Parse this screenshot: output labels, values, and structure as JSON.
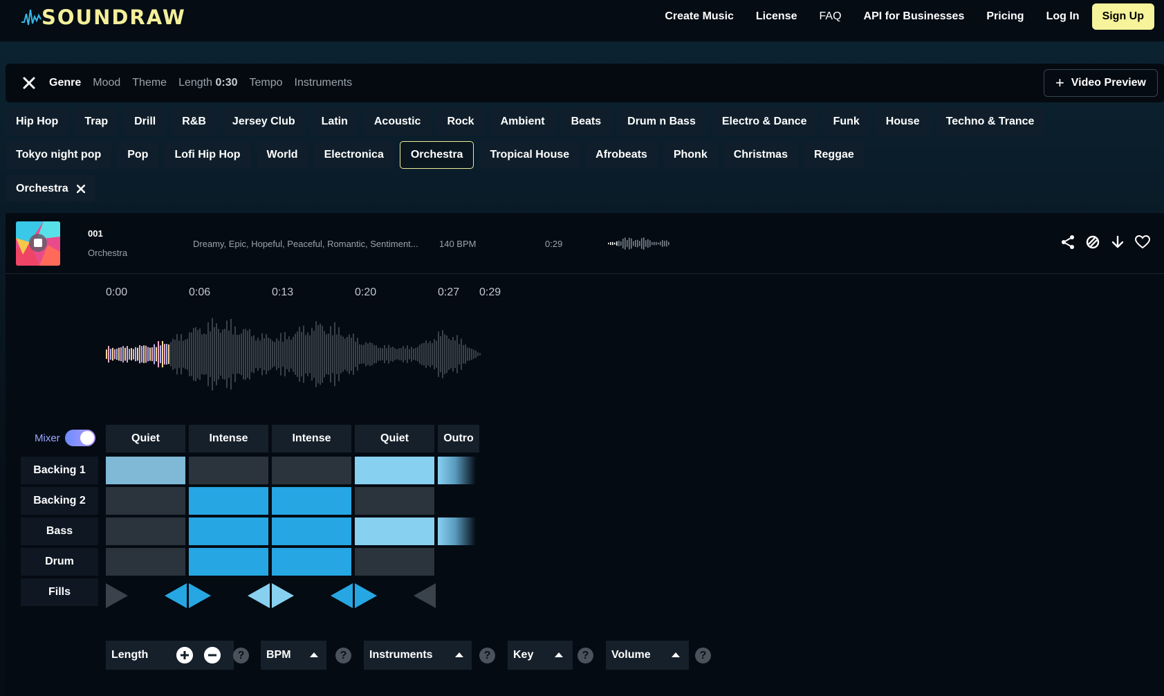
{
  "brand": {
    "name": "SOUNDRAW",
    "accent": "#f6f39a",
    "logo_icon": "waveform-logo-icon"
  },
  "nav": {
    "links": [
      "Create Music",
      "License",
      "FAQ",
      "API for Businesses",
      "Pricing",
      "Log In"
    ],
    "signup": "Sign Up"
  },
  "filters": {
    "tabs": [
      "Genre",
      "Mood",
      "Theme",
      "Length",
      "Tempo",
      "Instruments"
    ],
    "active_tab": "Genre",
    "length_value": "0:30",
    "video_preview": "Video Preview"
  },
  "genres": {
    "row1": [
      "Hip Hop",
      "Trap",
      "Drill",
      "R&B",
      "Jersey Club",
      "Latin",
      "Acoustic",
      "Rock",
      "Ambient",
      "Beats",
      "Drum n Bass",
      "Electro & Dance",
      "Funk",
      "House",
      "Techno & Trance"
    ],
    "row2": [
      "Tokyo night pop",
      "Pop",
      "Lofi Hip Hop",
      "World",
      "Electronica",
      "Orchestra",
      "Tropical House",
      "Afrobeats",
      "Phonk",
      "Christmas",
      "Reggae"
    ],
    "selected": "Orchestra"
  },
  "selected_filter": {
    "label": "Orchestra"
  },
  "track": {
    "number": "001",
    "genre": "Orchestra",
    "tags": "Dreamy, Epic, Hopeful, Peaceful, Romantic, Sentiment...",
    "bpm": "140 BPM",
    "duration": "0:29",
    "actions": [
      "share-icon",
      "similar-icon",
      "download-icon",
      "heart-icon"
    ]
  },
  "timeline": {
    "labels": [
      "0:00",
      "0:06",
      "0:13",
      "0:20",
      "0:27",
      "0:29"
    ],
    "played_fraction": 0.17
  },
  "mixer": {
    "label": "Mixer",
    "enabled": true,
    "sections": [
      "Quiet",
      "Intense",
      "Intense",
      "Quiet",
      "Outro"
    ],
    "rows": [
      {
        "name": "Backing 1",
        "cells": [
          "dim",
          "off",
          "off",
          "light",
          "fade"
        ]
      },
      {
        "name": "Backing 2",
        "cells": [
          "off",
          "on",
          "on",
          "off",
          "none"
        ]
      },
      {
        "name": "Bass",
        "cells": [
          "off",
          "on",
          "on",
          "light",
          "fade"
        ]
      },
      {
        "name": "Drum",
        "cells": [
          "off",
          "on",
          "on",
          "off",
          "none"
        ]
      }
    ],
    "fills_label": "Fills"
  },
  "controls": {
    "length": "Length",
    "bpm": "BPM",
    "instruments": "Instruments",
    "key": "Key",
    "volume": "Volume",
    "help": "?"
  }
}
